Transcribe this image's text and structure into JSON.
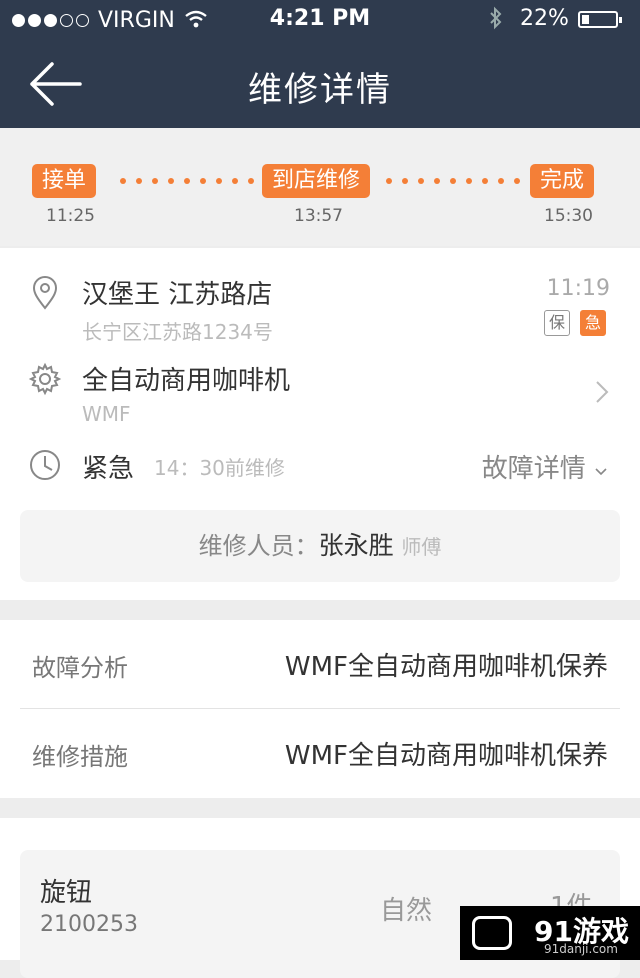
{
  "status_bar": {
    "carrier": "VIRGIN",
    "time": "4:21 PM",
    "battery": "22%"
  },
  "nav": {
    "title": "维修详情"
  },
  "timeline": {
    "stages": [
      {
        "label": "接单",
        "time": "11:25"
      },
      {
        "label": "到店维修",
        "time": "13:57"
      },
      {
        "label": "完成",
        "time": "15:30"
      }
    ]
  },
  "order": {
    "store_name": "汉堡王 江苏路店",
    "address": "长宁区江苏路1234号",
    "time": "11:19",
    "tag_warranty": "保",
    "tag_urgent": "急",
    "equipment": "全自动商用咖啡机",
    "brand": "WMF",
    "urgency": "紧急",
    "deadline": "14：30前维修",
    "fault_detail_link": "故障详情",
    "staff_label": "维修人员：",
    "staff_name": "张永胜",
    "staff_role": "师傅"
  },
  "analysis": {
    "fault_label": "故障分析",
    "fault_value": "WMF全自动商用咖啡机保养",
    "measure_label": "维修措施",
    "measure_value": "WMF全自动商用咖啡机保养"
  },
  "parts": [
    {
      "name": "旋钮",
      "code": "2100253",
      "mode": "自然",
      "qty": "1件"
    }
  ],
  "watermark": {
    "name": "91游戏",
    "url": "91danji.com"
  }
}
